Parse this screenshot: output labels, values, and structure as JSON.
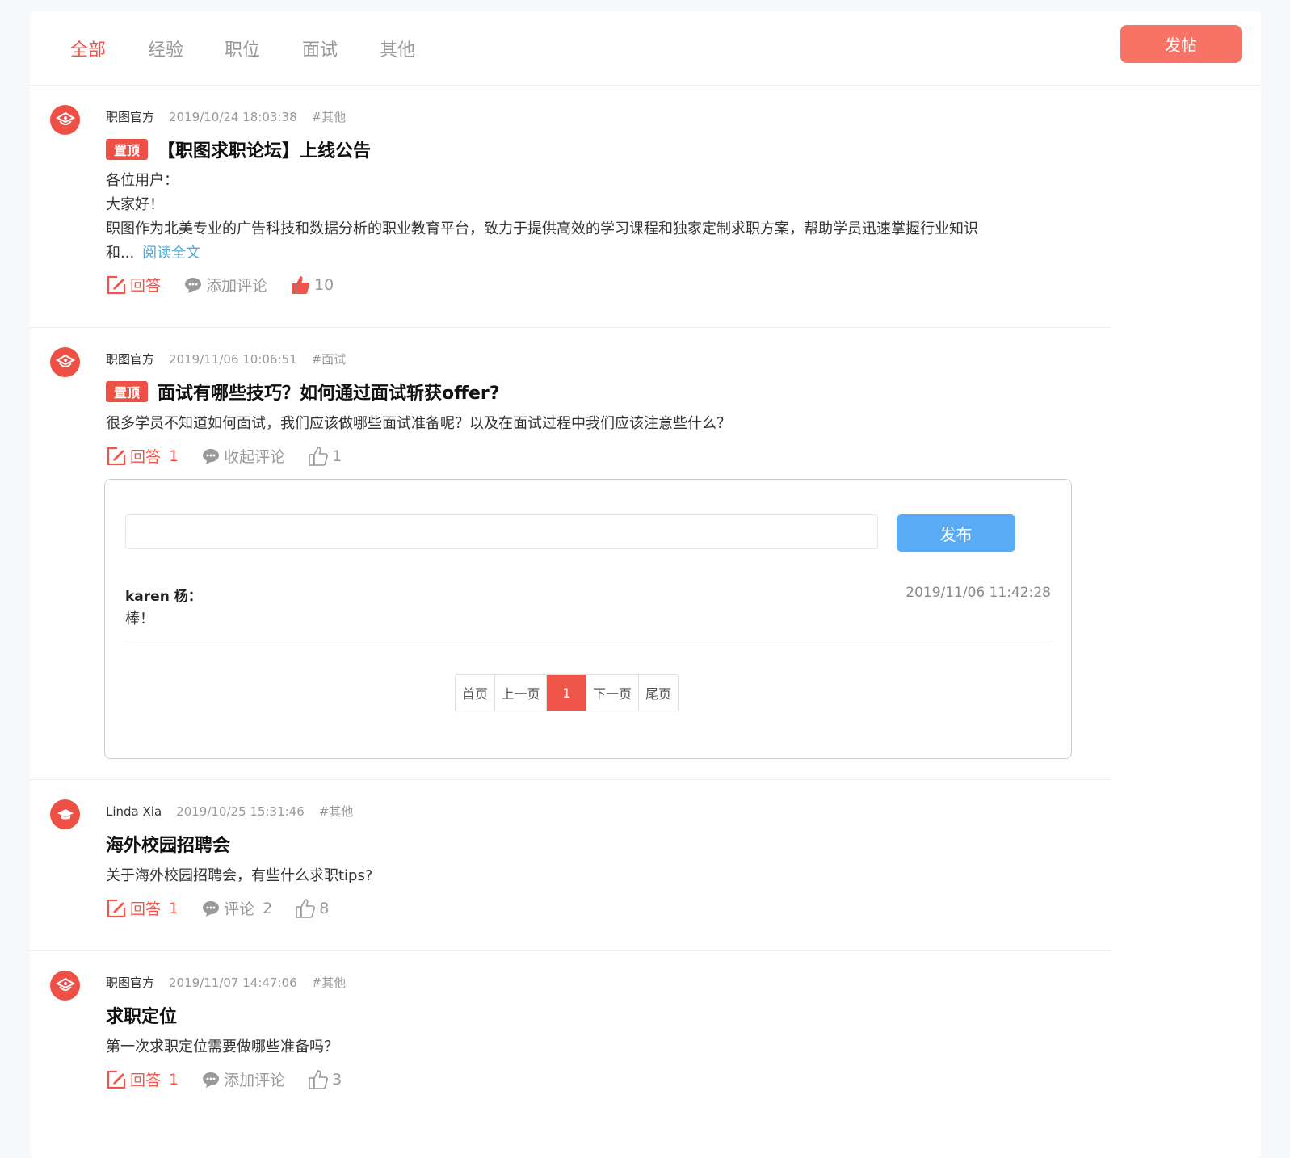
{
  "tabs": [
    "全部",
    "经验",
    "职位",
    "面试",
    "其他"
  ],
  "post_button": "发帖",
  "posts": [
    {
      "author": "职图官方",
      "time": "2019/10/24 18:03:38",
      "tag": "#其他",
      "pinned_label": "置顶",
      "title": "【职图求职论坛】上线公告",
      "content_lines": [
        "各位用户：",
        "大家好！",
        "职图作为北美专业的广告科技和数据分析的职业教育平台，致力于提供高效的学习课程和独家定制求职方案，帮助学员迅速掌握行业知识",
        "和..."
      ],
      "read_more": "阅读全文",
      "answer_label": "回答",
      "answer_count": "",
      "comment_label": "添加评论",
      "comment_count": "",
      "likes": "10"
    },
    {
      "author": "职图官方",
      "time": "2019/11/06 10:06:51",
      "tag": "#面试",
      "pinned_label": "置顶",
      "title": "面试有哪些技巧？如何通过面试斩获offer?",
      "content": "很多学员不知道如何面试，我们应该做哪些面试准备呢？以及在面试过程中我们应该注意些什么？",
      "answer_label": "回答",
      "answer_count": "1",
      "comment_label": "收起评论",
      "comment_count": "",
      "likes": "1"
    },
    {
      "author": "Linda Xia",
      "time": "2019/10/25 15:31:46",
      "tag": "#其他",
      "title": "海外校园招聘会",
      "content": "关于海外校园招聘会，有些什么求职tips?",
      "answer_label": "回答",
      "answer_count": "1",
      "comment_label": "评论",
      "comment_count": "2",
      "likes": "8"
    },
    {
      "author": "职图官方",
      "time": "2019/11/07 14:47:06",
      "tag": "#其他",
      "title": "求职定位",
      "content": "第一次求职定位需要做哪些准备吗？",
      "answer_label": "回答",
      "answer_count": "1",
      "comment_label": "添加评论",
      "comment_count": "",
      "likes": "3"
    }
  ],
  "comment_panel": {
    "publish_button": "发布",
    "comment": {
      "user": "karen 杨：",
      "time": "2019/11/06 11:42:28",
      "text": "棒！"
    },
    "pagination": {
      "first": "首页",
      "prev": "上一页",
      "current": "1",
      "next": "下一页",
      "last": "尾页"
    }
  },
  "colors": {
    "accent": "#f0554a",
    "post_button": "#f87366",
    "publish_button": "#5aabf5",
    "link": "#4fa8d8"
  },
  "icons": {
    "official_avatar": "zhitu-logo-icon",
    "user_avatar": "graduation-cap-icon",
    "answer": "edit-icon",
    "comment": "chat-bubble-icon",
    "like": "thumbs-up-icon"
  }
}
